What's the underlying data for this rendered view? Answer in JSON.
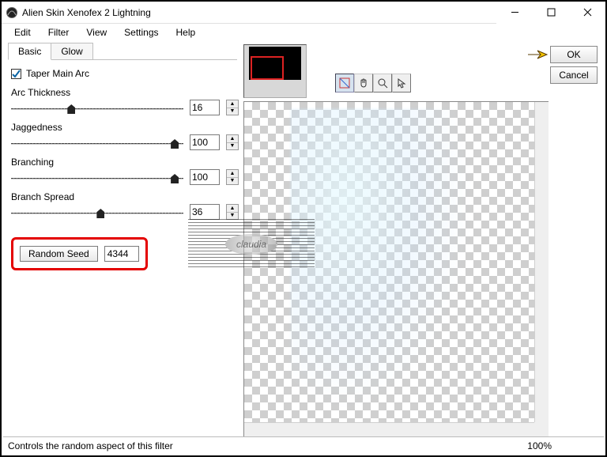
{
  "window": {
    "title": "Alien Skin Xenofex 2 Lightning"
  },
  "menubar": [
    "Edit",
    "Filter",
    "View",
    "Settings",
    "Help"
  ],
  "tabs": {
    "basic": "Basic",
    "glow": "Glow"
  },
  "taper": {
    "label": "Taper Main Arc",
    "checked": true
  },
  "sliders": {
    "arc_thickness": {
      "label": "Arc Thickness",
      "value": "16",
      "pos": 35
    },
    "jaggedness": {
      "label": "Jaggedness",
      "value": "100",
      "pos": 95
    },
    "branching": {
      "label": "Branching",
      "value": "100",
      "pos": 95
    },
    "branch_spread": {
      "label": "Branch Spread",
      "value": "36",
      "pos": 52
    }
  },
  "random": {
    "button": "Random Seed",
    "value": "4344"
  },
  "buttons": {
    "ok": "OK",
    "cancel": "Cancel"
  },
  "status": {
    "text": "Controls the random aspect of this filter",
    "zoom": "100%"
  },
  "watermark": "claudia"
}
